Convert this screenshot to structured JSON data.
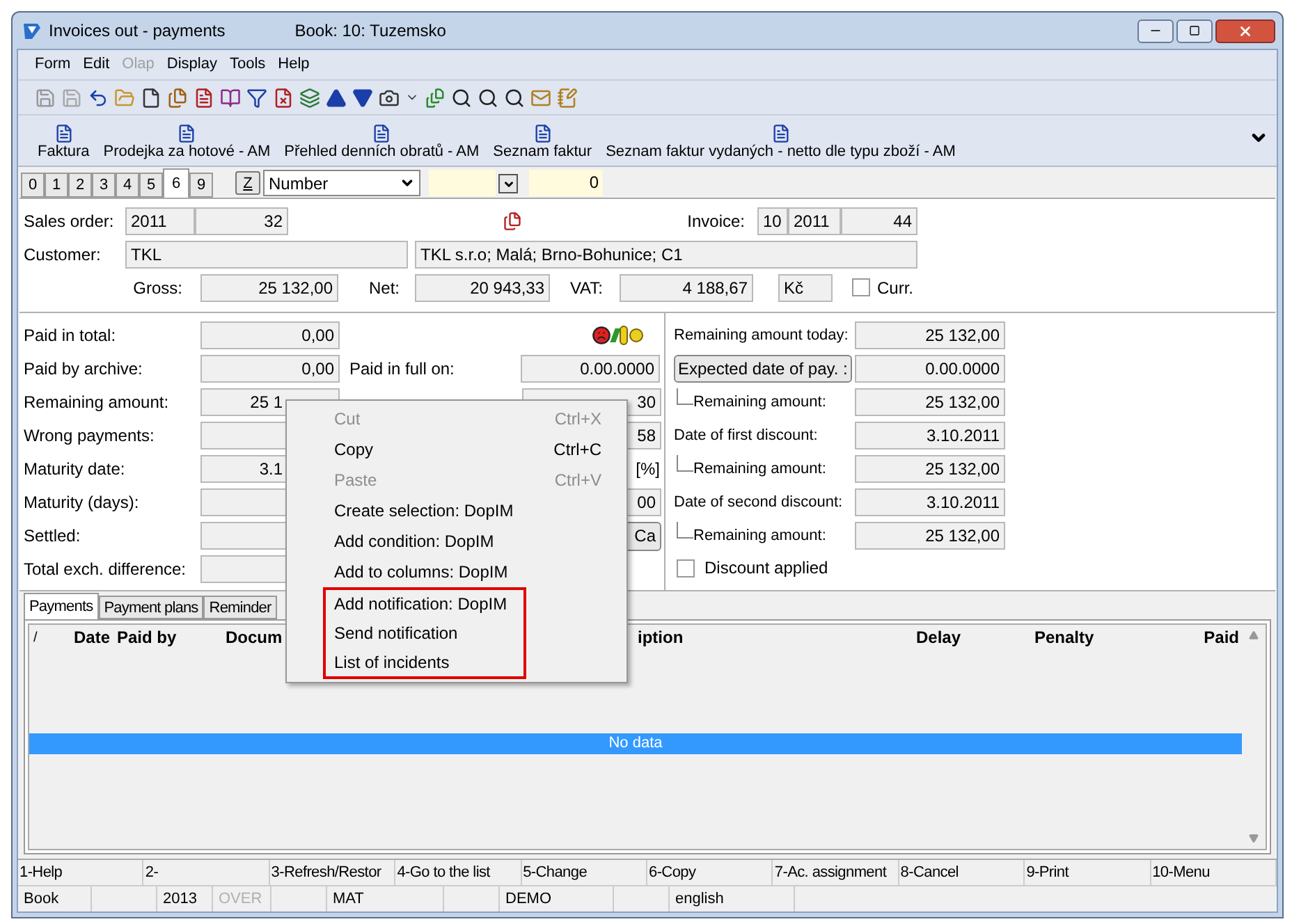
{
  "window": {
    "title": "Invoices out - payments",
    "book": "Book: 10: Tuzemsko"
  },
  "menu": [
    {
      "label": "Form",
      "disabled": false
    },
    {
      "label": "Edit",
      "disabled": false
    },
    {
      "label": "Olap",
      "disabled": true
    },
    {
      "label": "Display",
      "disabled": false
    },
    {
      "label": "Tools",
      "disabled": false
    },
    {
      "label": "Help",
      "disabled": false
    }
  ],
  "reports": [
    "Faktura",
    "Prodejka za hotové - AM",
    "Přehled denních obratů - AM",
    "Seznam faktur",
    "Seznam faktur vydaných - netto dle typu zboží - AM"
  ],
  "page_tabs": [
    {
      "label": "0",
      "selected": false
    },
    {
      "label": "1",
      "selected": false
    },
    {
      "label": "2",
      "selected": false
    },
    {
      "label": "3",
      "selected": false
    },
    {
      "label": "4",
      "selected": false
    },
    {
      "label": "5",
      "selected": false
    },
    {
      "label": "6",
      "selected": true
    },
    {
      "label": "9",
      "selected": false
    }
  ],
  "z_button": "Z",
  "sort_select": "Number",
  "filter_value": "0",
  "header": {
    "sales_order": {
      "label": "Sales order:",
      "year": "2011",
      "number": "32"
    },
    "invoice": {
      "label": "Invoice:",
      "book": "10",
      "year": "2011",
      "number": "44"
    },
    "customer": {
      "label": "Customer:",
      "code": "TKL",
      "address": "TKL s.r.o; Malá; Brno-Bohunice; C1"
    },
    "gross": {
      "label": "Gross:",
      "value": "25 132,00"
    },
    "net": {
      "label": "Net:",
      "value": "20 943,33"
    },
    "vat": {
      "label": "VAT:",
      "value": "4 188,67"
    },
    "currency": "Kč",
    "curr": {
      "label": "Curr.",
      "checked": false
    }
  },
  "left_rows": [
    {
      "label": "Paid in total:",
      "value": "0,00"
    },
    {
      "label": "Paid by archive:",
      "value": "0,00"
    },
    {
      "label": "Remaining amount:",
      "value": "25 1"
    },
    {
      "label": "Wrong payments:",
      "value": ""
    },
    {
      "label": "Maturity date:",
      "value": "3.1"
    },
    {
      "label": "Maturity (days):",
      "value": ""
    },
    {
      "label": "Settled:",
      "value": ""
    },
    {
      "label": "Total exch. difference:",
      "value": ""
    }
  ],
  "middle": {
    "paid_in_full": {
      "label": "Paid in full on:",
      "value": "0.00.0000"
    },
    "rows": [
      {
        "kind": "field",
        "value": "30"
      },
      {
        "kind": "field",
        "value": "58"
      },
      {
        "kind": "text",
        "value": "[%]"
      },
      {
        "kind": "field",
        "value": "00"
      },
      {
        "kind": "button",
        "value": "Ca"
      }
    ]
  },
  "right_rows": [
    {
      "kind": "label",
      "label": "Remaining amount today:",
      "value": "25 132,00"
    },
    {
      "kind": "button",
      "label": "Expected date of pay. :",
      "value": "0.00.0000"
    },
    {
      "kind": "sub",
      "label": "Remaining amount:",
      "value": "25 132,00"
    },
    {
      "kind": "label",
      "label": "Date of first discount:",
      "value": "3.10.2011"
    },
    {
      "kind": "sub",
      "label": "Remaining amount:",
      "value": "25 132,00"
    },
    {
      "kind": "label",
      "label": "Date of second discount:",
      "value": "3.10.2011"
    },
    {
      "kind": "sub",
      "label": "Remaining amount:",
      "value": "25 132,00"
    }
  ],
  "discount_applied": {
    "label": "Discount applied",
    "checked": false
  },
  "bottom_tabs": [
    {
      "label": "Payments",
      "selected": true
    },
    {
      "label": "Payment plans",
      "selected": false
    },
    {
      "label": "Reminder",
      "selected": false
    }
  ],
  "table": {
    "columns": [
      "/",
      "Date",
      "Paid by",
      "Docum",
      "iption",
      "Delay",
      "Penalty",
      "Paid"
    ],
    "empty": "No data"
  },
  "context_menu": [
    {
      "label": "Cut",
      "shortcut": "Ctrl+X",
      "disabled": true,
      "highlighted": false
    },
    {
      "label": "Copy",
      "shortcut": "Ctrl+C",
      "disabled": false,
      "highlighted": false
    },
    {
      "label": "Paste",
      "shortcut": "Ctrl+V",
      "disabled": true,
      "highlighted": false
    },
    {
      "label": "Create selection: DopIM",
      "disabled": false,
      "highlighted": false
    },
    {
      "label": "Add condition: DopIM",
      "disabled": false,
      "highlighted": false
    },
    {
      "label": "Add to columns: DopIM",
      "disabled": false,
      "highlighted": false
    },
    {
      "label": "Add notification: DopIM",
      "disabled": false,
      "highlighted": true
    },
    {
      "label": "Send notification",
      "disabled": false,
      "highlighted": true
    },
    {
      "label": "List of incidents",
      "disabled": false,
      "highlighted": true
    }
  ],
  "function_keys": [
    "1-Help",
    "2-",
    "3-Refresh/Restor",
    "4-Go to the list",
    "5-Change",
    "6-Copy",
    "7-Ac. assignment",
    "8-Cancel",
    "9-Print",
    "10-Menu"
  ],
  "status_bar": [
    {
      "text": "Book",
      "disabled": false
    },
    {
      "text": "2013",
      "disabled": false
    },
    {
      "text": "OVER",
      "disabled": true
    },
    {
      "text": "MAT",
      "disabled": false
    },
    {
      "text": "DEMO",
      "disabled": false
    },
    {
      "text": "english",
      "disabled": false
    }
  ]
}
